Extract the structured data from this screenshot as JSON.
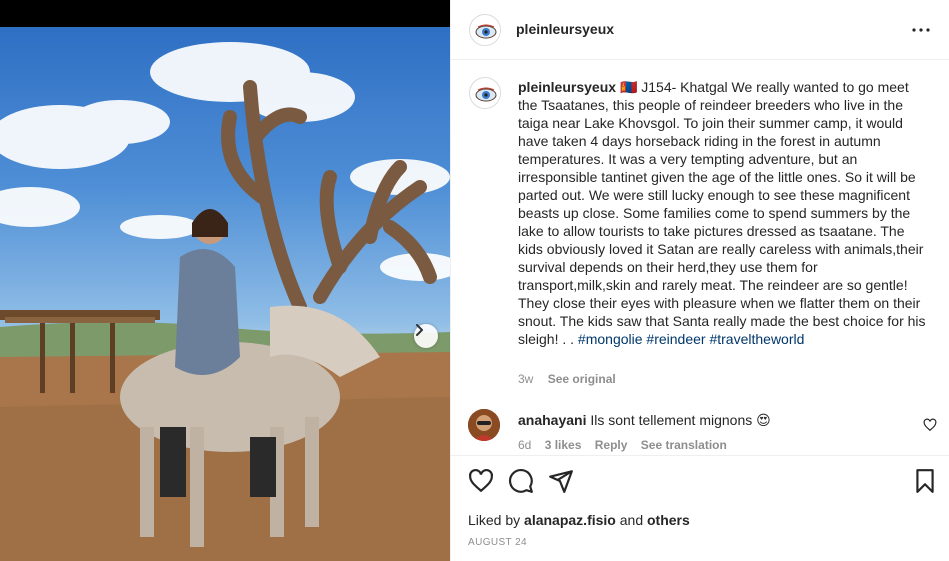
{
  "post": {
    "username": "pleinleursyeux",
    "more_icon": "more-dots-icon",
    "next_icon": "chevron-right-icon"
  },
  "caption": {
    "username": "pleinleursyeux",
    "flag": "🇲🇳",
    "text": "J154- Khatgal We really wanted to go meet the Tsaatanes, this people of reindeer breeders who live in the taiga near Lake Khovsgol. To join their summer camp, it would have taken 4 days horseback riding in the forest in autumn temperatures. It was a very tempting adventure, but an irresponsible tantinet given the age of the little ones. So it will be parted out. We were still lucky enough to see these magnificent beasts up close. Some families come to spend summers by the lake to allow tourists to take pictures dressed as tsaatane. The kids obviously loved it Satan are really careless with animals,their survival depends on their herd,they use them for transport,milk,skin and rarely meat. The reindeer are so gentle! They close their eyes with pleasure when we flatter them on their snout. The kids saw that Santa really made the best choice for his sleigh! . .",
    "tags": [
      "#mongolie",
      "#reindeer",
      "#traveltheworld"
    ],
    "time": "3w",
    "see_original": "See original"
  },
  "comment": {
    "username": "anahayani",
    "text": "Ils sont tellement mignons 😍",
    "time": "6d",
    "likes": "3 likes",
    "reply": "Reply",
    "see_translation": "See translation"
  },
  "actions": {
    "icons": [
      "heart-icon",
      "comment-icon",
      "share-icon",
      "bookmark-icon"
    ]
  },
  "likes": {
    "prefix": "Liked by",
    "user": "alanapaz.fisio",
    "and": "and",
    "others": "others"
  },
  "date": "AUGUST 24",
  "colors": {
    "link": "#00376b",
    "muted": "#8e8e8e",
    "text": "#262626"
  }
}
